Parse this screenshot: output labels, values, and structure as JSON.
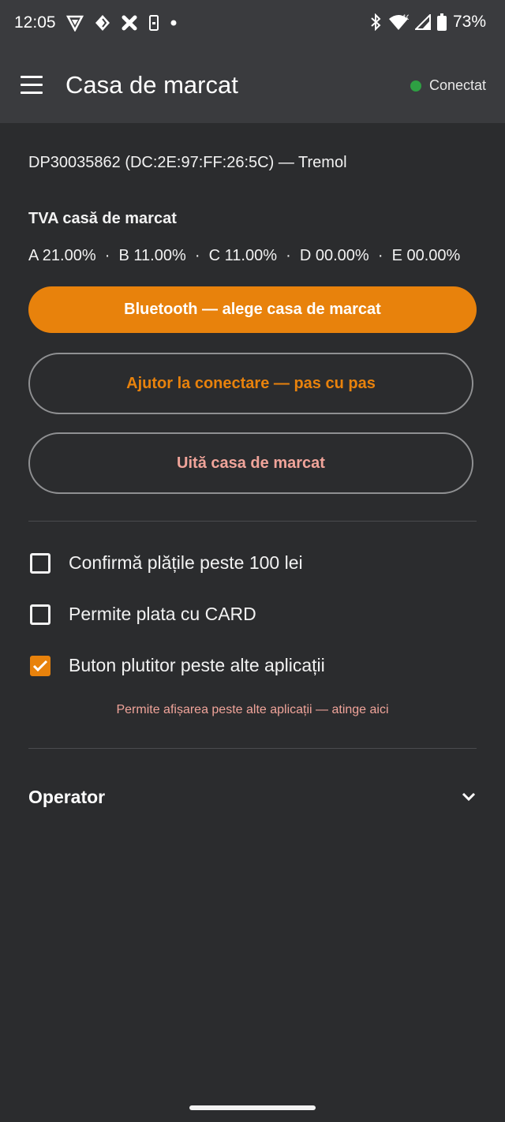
{
  "status_bar": {
    "time": "12:05",
    "battery": "73%",
    "network": "4G",
    "left_icons": [
      "vpn-shield-icon",
      "diamond-app-icon",
      "crossed-app-icon",
      "phone-app-icon",
      "dot-icon"
    ],
    "right_icons": [
      "bluetooth-icon",
      "wifi-icon",
      "signal-icon",
      "battery-icon"
    ]
  },
  "app_bar": {
    "title": "Casa de marcat",
    "menu_icon": "hamburger-menu-icon",
    "connection_label": "Conectat",
    "connection_color": "#2ea043"
  },
  "device": {
    "info": "DP30035862 (DC:2E:97:FF:26:5C) — Tremol"
  },
  "tva": {
    "title": "TVA casă de marcat",
    "rates_text": "A 21.00%  ·  B 11.00%  ·  C 11.00%  ·  D 00.00%  ·  E 00.00%"
  },
  "buttons": {
    "bluetooth": "Bluetooth — alege casa de marcat",
    "help": "Ajutor la conectare — pas cu pas",
    "forget": "Uită casa de marcat"
  },
  "options": [
    {
      "label": "Confirmă plățile peste 100 lei",
      "checked": false
    },
    {
      "label": "Permite plata cu CARD",
      "checked": false
    },
    {
      "label": "Buton plutitor peste alte aplicații",
      "checked": true
    }
  ],
  "overlay_hint": "Permite afișarea peste alte aplicații — atinge aici",
  "operator": {
    "label": "Operator",
    "icon": "chevron-down-icon"
  },
  "colors": {
    "accent": "#e8820c",
    "danger_text": "#f0a49a",
    "background": "#2b2c2e",
    "bar": "#3a3b3e"
  }
}
